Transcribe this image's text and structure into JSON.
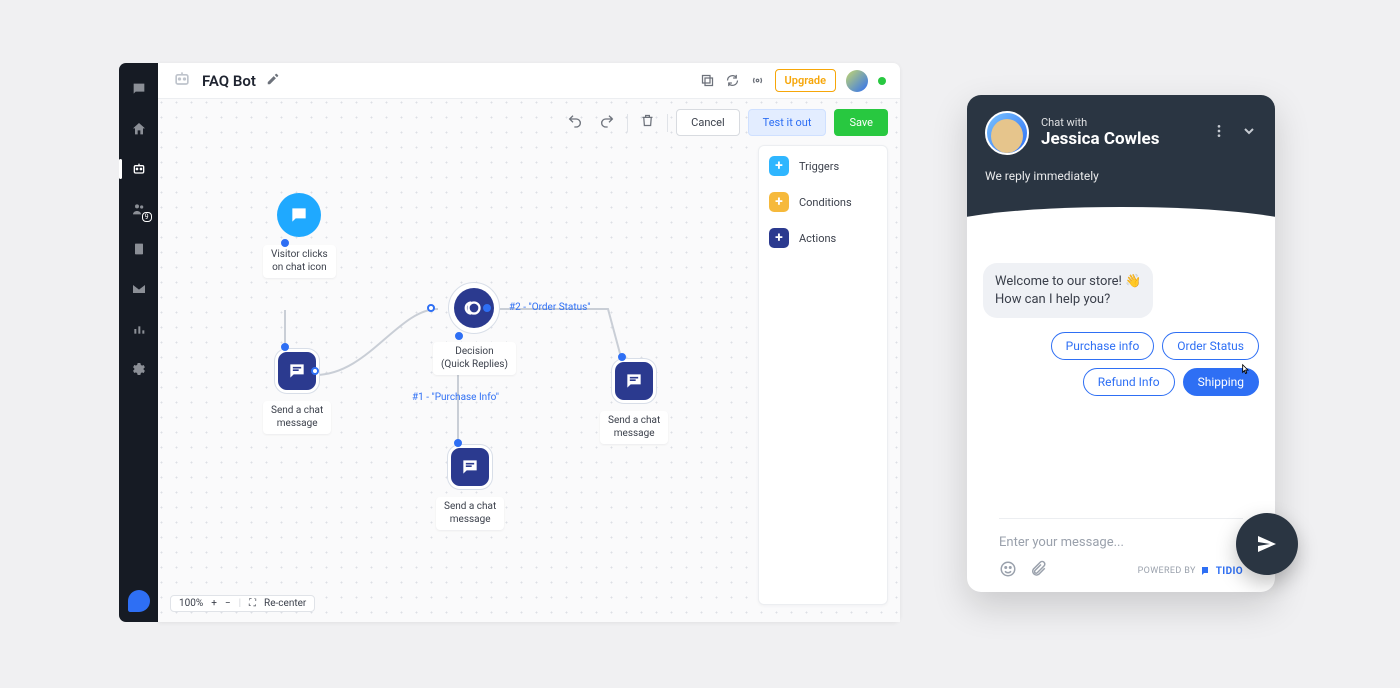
{
  "sidebar": {
    "items": [
      "chat",
      "home",
      "bots",
      "contacts",
      "company",
      "inbox",
      "analytics",
      "settings"
    ],
    "badge": "9"
  },
  "topbar": {
    "title": "FAQ Bot",
    "upgrade": "Upgrade"
  },
  "actionbar": {
    "cancel": "Cancel",
    "test": "Test it out",
    "save": "Save"
  },
  "panel": {
    "triggers": "Triggers",
    "conditions": "Conditions",
    "actions": "Actions"
  },
  "zoom": {
    "level": "100%",
    "recenter": "Re-center"
  },
  "nodes": {
    "trigger": {
      "label1": "Visitor clicks",
      "label2": "on chat icon"
    },
    "action1": {
      "label1": "Send a chat",
      "label2": "message"
    },
    "decision": {
      "label1": "Decision",
      "label2": "(Quick Replies)"
    },
    "edge1": "#1 - \"Purchase Info\"",
    "edge2": "#2 - \"Order Status\"",
    "action2": {
      "label1": "Send a chat",
      "label2": "message"
    },
    "action3": {
      "label1": "Send a chat",
      "label2": "message"
    }
  },
  "chat": {
    "with": "Chat with",
    "name": "Jessica Cowles",
    "reply": "We reply immediately",
    "welcome1": "Welcome to our store! 👋",
    "welcome2": "How can I help you?",
    "qr": [
      "Purchase info",
      "Order Status",
      "Refund Info",
      "Shipping"
    ],
    "placeholder": "Enter your message...",
    "powered": "POWERED BY",
    "brand": "TIDIO"
  }
}
